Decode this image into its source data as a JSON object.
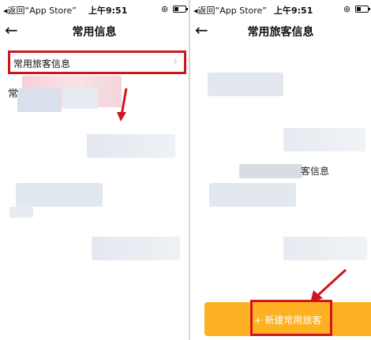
{
  "left_screen": {
    "status_bar": {
      "back_label": "◂返回“App Store”",
      "time": "上午9:51"
    },
    "nav": {
      "back_icon": "arrow-left-icon",
      "title": "常用信息"
    },
    "menu_item": {
      "label": "常用旅客信息",
      "chevron": "›"
    },
    "partial_char": "常"
  },
  "right_screen": {
    "status_bar": {
      "back_label": "◂返回“App Store”",
      "time": "上午9:51"
    },
    "nav": {
      "back_icon": "arrow-left-icon",
      "title": "常用旅客信息"
    },
    "partial_text": "客信息",
    "add_button": {
      "label": "+ 新建常用旅客"
    }
  },
  "colors": {
    "highlight": "#d0161b",
    "button": "#fdb022"
  }
}
